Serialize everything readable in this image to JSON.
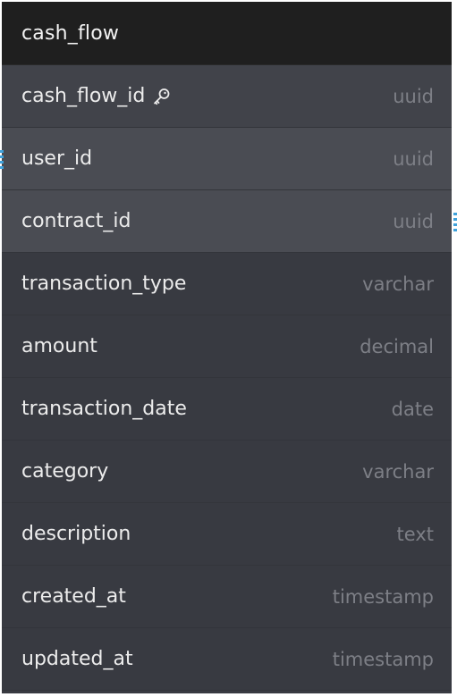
{
  "table": {
    "name": "cash_flow",
    "columns": [
      {
        "name": "cash_flow_id",
        "type": "uuid",
        "primary_key": true,
        "icon": "key-icon"
      },
      {
        "name": "user_id",
        "type": "uuid",
        "foreign_key": true
      },
      {
        "name": "contract_id",
        "type": "uuid",
        "foreign_key": true
      },
      {
        "name": "transaction_type",
        "type": "varchar"
      },
      {
        "name": "amount",
        "type": "decimal"
      },
      {
        "name": "transaction_date",
        "type": "date"
      },
      {
        "name": "category",
        "type": "varchar"
      },
      {
        "name": "description",
        "type": "text"
      },
      {
        "name": "created_at",
        "type": "timestamp"
      },
      {
        "name": "updated_at",
        "type": "timestamp"
      }
    ]
  },
  "colors": {
    "header_bg": "#1f1f1f",
    "body_bg": "#383a41",
    "pk_row_bg": "#41434a",
    "fk_row_bg": "#4a4c53",
    "connector": "#3fa2dc"
  }
}
